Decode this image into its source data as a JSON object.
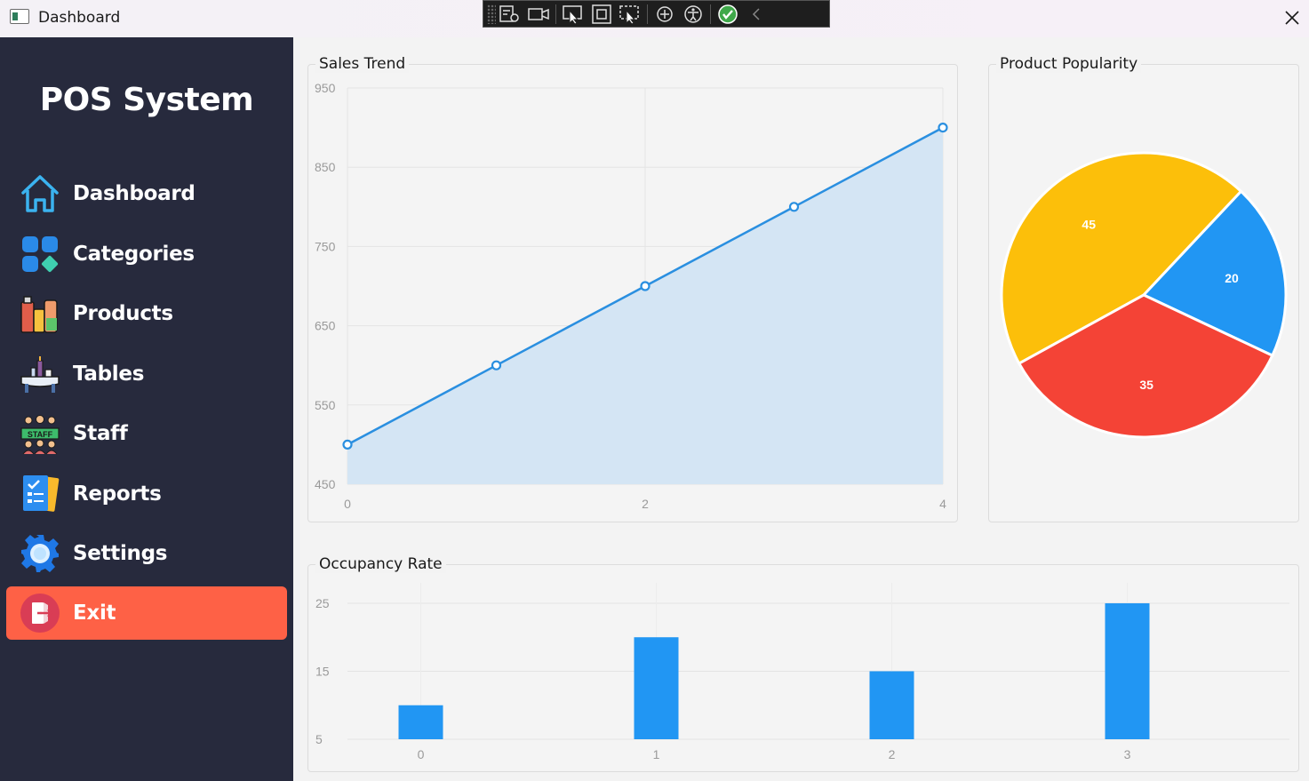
{
  "window": {
    "title": "Dashboard"
  },
  "sidebar": {
    "brand": "POS System",
    "items": [
      {
        "label": "Dashboard",
        "icon": "home-icon"
      },
      {
        "label": "Categories",
        "icon": "categories-icon"
      },
      {
        "label": "Products",
        "icon": "products-icon"
      },
      {
        "label": "Tables",
        "icon": "tables-icon"
      },
      {
        "label": "Staff",
        "icon": "staff-icon"
      },
      {
        "label": "Reports",
        "icon": "reports-icon"
      },
      {
        "label": "Settings",
        "icon": "gear-icon"
      },
      {
        "label": "Exit",
        "icon": "exit-icon"
      }
    ],
    "exit_color": "#fe6146",
    "background": "#272a3d"
  },
  "panels": {
    "sales_trend": "Sales Trend",
    "product_popularity": "Product Popularity",
    "occupancy_rate": "Occupancy Rate"
  },
  "chart_data": [
    {
      "type": "area",
      "title": "Sales Trend",
      "x": [
        0,
        1,
        2,
        3,
        4
      ],
      "y": [
        500,
        600,
        700,
        800,
        900
      ],
      "xticks": [
        0,
        2,
        4
      ],
      "yticks": [
        450,
        550,
        650,
        750,
        850,
        950
      ],
      "xlim": [
        0,
        4
      ],
      "ylim": [
        450,
        950
      ],
      "color": "#2a8fe0",
      "fill": "#d4e5f4",
      "grid": true
    },
    {
      "type": "pie",
      "title": "Product Popularity",
      "values": [
        45,
        20,
        35
      ],
      "colors": [
        "#fcbf0a",
        "#2196f3",
        "#f44336"
      ]
    },
    {
      "type": "bar",
      "title": "Occupancy Rate",
      "categories": [
        "0",
        "1",
        "2",
        "3"
      ],
      "values": [
        10,
        20,
        15,
        25
      ],
      "yticks": [
        5,
        15,
        25
      ],
      "ylim": [
        5,
        28
      ],
      "color": "#2196f3",
      "grid": true
    }
  ]
}
